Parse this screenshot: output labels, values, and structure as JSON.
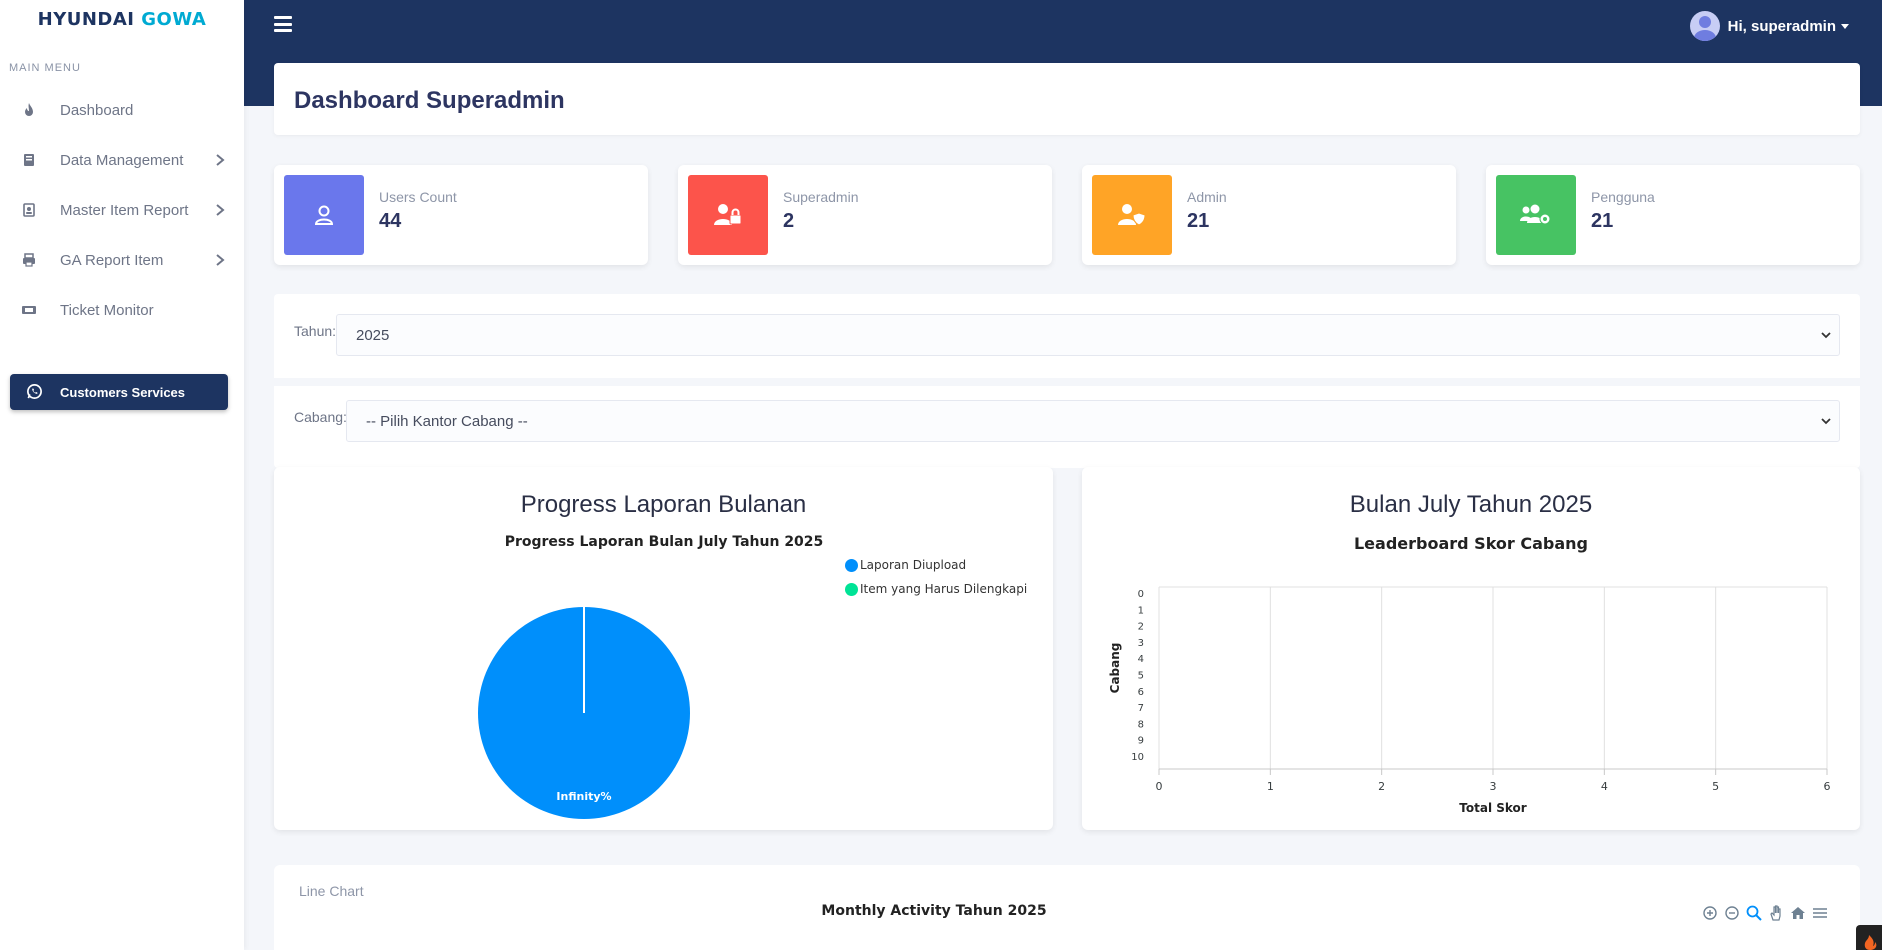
{
  "brand": {
    "part1": "HYUNDAI",
    "part2": "GOWA"
  },
  "sidebar": {
    "section_title": "MAIN MENU",
    "items": [
      {
        "label": "Dashboard",
        "icon": "fire-icon",
        "has_submenu": false
      },
      {
        "label": "Data Management",
        "icon": "book-icon",
        "has_submenu": true
      },
      {
        "label": "Master Item Report",
        "icon": "contact-card-icon",
        "has_submenu": true
      },
      {
        "label": "GA Report Item",
        "icon": "printer-icon",
        "has_submenu": true
      },
      {
        "label": "Ticket Monitor",
        "icon": "ticket-icon",
        "has_submenu": false
      }
    ],
    "cta": {
      "label": "Customers Services",
      "icon": "whatsapp-icon"
    }
  },
  "topbar": {
    "user_greeting": "Hi, superadmin"
  },
  "page": {
    "title": "Dashboard Superadmin"
  },
  "stats": [
    {
      "label": "Users Count",
      "value": "44",
      "color": "#6a77ec",
      "icon": "user-icon"
    },
    {
      "label": "Superadmin",
      "value": "2",
      "color": "#fc544b",
      "icon": "user-lock-icon"
    },
    {
      "label": "Admin",
      "value": "21",
      "color": "#ffa426",
      "icon": "user-shield-icon"
    },
    {
      "label": "Pengguna",
      "value": "21",
      "color": "#47c363",
      "icon": "users-cog-icon"
    }
  ],
  "filters": {
    "year": {
      "label": "Tahun:",
      "value": "2025"
    },
    "branch": {
      "label": "Cabang:",
      "value": "-- Pilih Kantor Cabang --"
    }
  },
  "pie_card": {
    "heading": "Progress Laporan Bulanan"
  },
  "bar_card": {
    "heading": "Bulan July Tahun 2025"
  },
  "chart_data": [
    {
      "type": "pie",
      "title": "Progress Laporan Bulan July Tahun 2025",
      "legend": [
        "Laporan Diupload",
        "Item yang Harus Dilengkapi"
      ],
      "colors": [
        "#008ffb",
        "#00e396"
      ],
      "values": [
        100,
        0
      ],
      "slice_label": "Infinity%",
      "legend_position": "top-right"
    },
    {
      "type": "bar",
      "title": "Leaderboard Skor Cabang",
      "orientation": "horizontal",
      "xlabel": "Total Skor",
      "ylabel": "Cabang",
      "x_ticks": [
        "0",
        "1",
        "2",
        "3",
        "4",
        "5",
        "6"
      ],
      "y_ticks": [
        "0",
        "1",
        "2",
        "3",
        "4",
        "5",
        "6",
        "7",
        "8",
        "9",
        "10"
      ],
      "xlim": [
        0,
        6
      ],
      "series": [],
      "grid": "vertical"
    },
    {
      "type": "line",
      "title": "Monthly Activity Tahun 2025",
      "panel_label": "Line Chart",
      "toolbar": [
        "zoom-in-icon",
        "zoom-out-icon",
        "zoom-select-icon",
        "pan-hand-icon",
        "home-icon",
        "menu-icon"
      ]
    }
  ]
}
